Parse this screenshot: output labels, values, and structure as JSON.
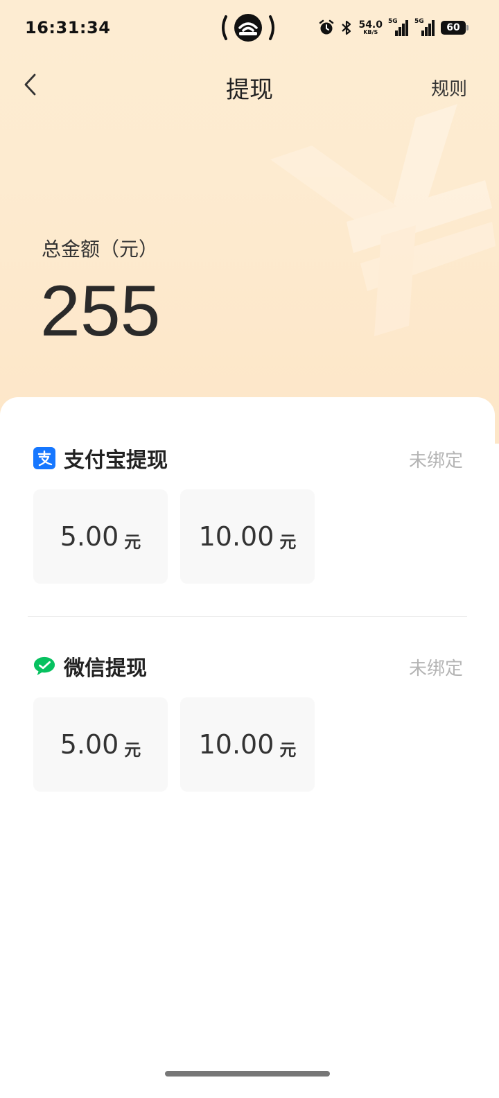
{
  "status_bar": {
    "time": "16:31:34",
    "net_speed_value": "54.0",
    "net_speed_unit": "KB/S",
    "signal_1_label": "5G",
    "signal_2_label": "5G",
    "battery_level": "60"
  },
  "nav": {
    "title": "提现",
    "rules_label": "规则"
  },
  "balance": {
    "label": "总金额（元）",
    "value": "255"
  },
  "sections": [
    {
      "title": "支付宝提现",
      "status": "未绑定",
      "icon": "alipay-icon",
      "color": "#1677ff",
      "amounts": [
        {
          "value": "5.00",
          "unit": "元"
        },
        {
          "value": "10.00",
          "unit": "元"
        }
      ]
    },
    {
      "title": "微信提现",
      "status": "未绑定",
      "icon": "wechat-icon",
      "color": "#07c160",
      "amounts": [
        {
          "value": "5.00",
          "unit": "元"
        },
        {
          "value": "10.00",
          "unit": "元"
        }
      ]
    }
  ],
  "icons": {
    "back": "chevron-left-icon",
    "alarm": "alarm-icon",
    "bluetooth": "bluetooth-icon",
    "status_center": "hotspot-icon"
  }
}
